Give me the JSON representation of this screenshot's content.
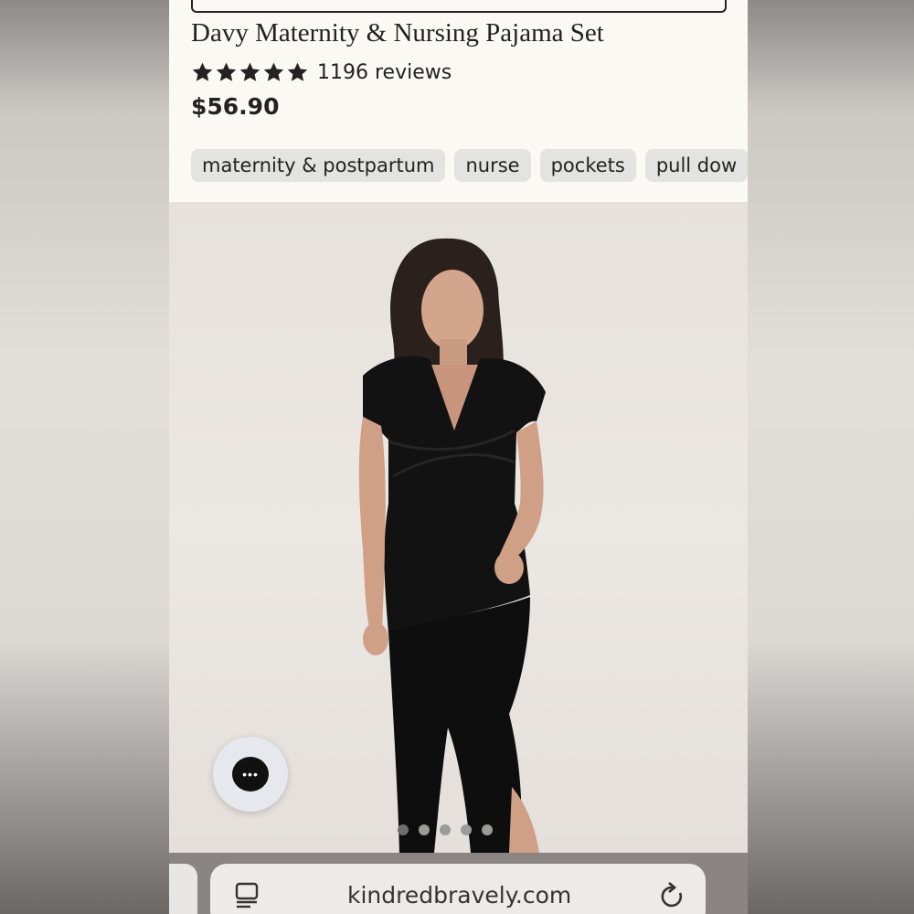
{
  "product": {
    "title": "Davy Maternity & Nursing Pajama Set",
    "rating_stars": 5,
    "reviews": "1196 reviews",
    "price": "$56.90",
    "tags": [
      "maternity & postpartum",
      "nurse",
      "pockets",
      "pull dow"
    ]
  },
  "gallery": {
    "dot_count": 5,
    "active_dot": 1
  },
  "browser": {
    "url": "kindredbravely.com"
  },
  "icons": {
    "star": "star-icon",
    "chat": "chat-icon",
    "reader": "reader-mode-icon",
    "reload": "reload-icon"
  },
  "colors": {
    "header_bg": "#fbf9f3",
    "tag_bg": "#e3e3e1",
    "text": "#222222"
  }
}
